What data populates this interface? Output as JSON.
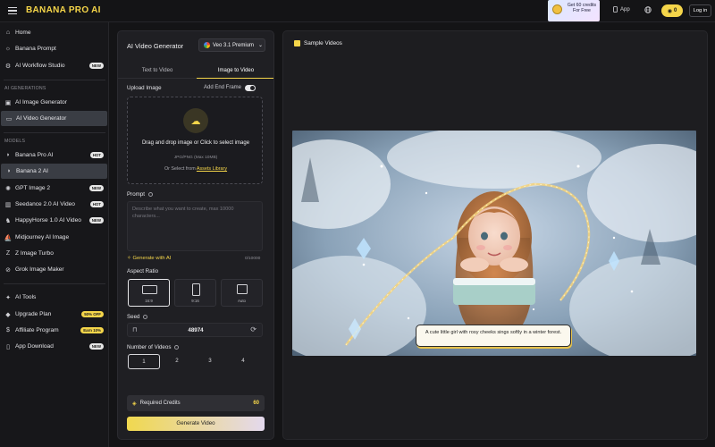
{
  "brand": {
    "name": "BANANA PRO AI"
  },
  "promo": {
    "text": "Get 60 credits For Free"
  },
  "topbar": {
    "app_label": "App",
    "credits": "0",
    "login_label": "Log in"
  },
  "sidebar": {
    "top_items": [
      {
        "label": "Home",
        "icon": "home-icon"
      },
      {
        "label": "Banana Prompt",
        "icon": "bulb-icon"
      },
      {
        "label": "AI Workflow Studio",
        "icon": "workflow-icon",
        "badge": "NEW"
      }
    ],
    "section_generations": "AI GENERATIONS",
    "generation_items": [
      {
        "label": "AI Image Generator",
        "icon": "image-icon"
      },
      {
        "label": "AI Video Generator",
        "icon": "video-icon"
      }
    ],
    "section_models": "MODELS",
    "model_items": [
      {
        "label": "Banana Pro AI",
        "badge": "HOT"
      },
      {
        "label": "Banana 2 AI"
      },
      {
        "label": "GPT Image 2",
        "badge": "NEW"
      },
      {
        "label": "Seedance 2.0 AI Video",
        "badge": "HOT"
      },
      {
        "label": "HappyHorse 1.0 AI Video",
        "badge": "NEW"
      },
      {
        "label": "Midjourney AI Image"
      },
      {
        "label": "Z Image Turbo"
      },
      {
        "label": "Grok Image Maker"
      }
    ],
    "bottom_items": [
      {
        "label": "AI Tools"
      },
      {
        "label": "Upgrade Plan",
        "badge": "50% OFF"
      },
      {
        "label": "Affiliate Program",
        "badge": "Earn 10%"
      },
      {
        "label": "App Download",
        "badge": "NEW"
      }
    ]
  },
  "generator": {
    "title": "AI Video Generator",
    "model": "Veo 3.1 Premium",
    "tabs": [
      "Text to Video",
      "Image to Video"
    ],
    "active_tab": "Image to Video",
    "upload_label": "Upload Image",
    "end_frame_label": "Add End Frame",
    "upload_main": "Drag and drop image or Click to select image",
    "upload_formats": "JPG/PNG (Max 10MB)",
    "upload_select_prefix": "Or Select from",
    "upload_select_link": "Assets Library",
    "prompt_label": "Prompt",
    "prompt_placeholder": "Describe what you want to create, max 10000 characters...",
    "generate_with_ai": "Generate with AI",
    "prompt_counter": "0/10000",
    "aspect_label": "Aspect Ratio",
    "aspect_options": [
      "16:9",
      "9:16",
      "Auto"
    ],
    "aspect_selected": "16:9",
    "seed_label": "Seed",
    "seed_value": "48974",
    "videos_label": "Number of Videos",
    "video_counts": [
      "1",
      "2",
      "3",
      "4"
    ],
    "video_count_selected": "1",
    "required_credits_label": "Required Credits",
    "required_credits_value": "60",
    "generate_button": "Generate Video"
  },
  "samples": {
    "title": "Sample Videos",
    "caption": "A cute little girl with rosy cheeks sings softly in a winter forest."
  }
}
